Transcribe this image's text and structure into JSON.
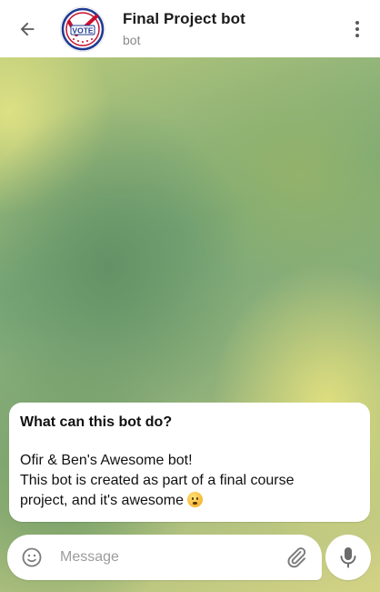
{
  "header": {
    "title": "Final Project bot",
    "subtitle": "bot",
    "avatar_text": "VOTE",
    "back_icon": "arrow-left-icon",
    "menu_icon": "more-vertical-icon"
  },
  "bot_info": {
    "heading": "What can this bot do?",
    "lines": [
      "Ofir & Ben's Awesome bot!",
      "This bot is created as part of a final course",
      "project, and it's awesome"
    ],
    "emoji": "kissing-face-emoji"
  },
  "composer": {
    "placeholder": "Message",
    "emoji_icon": "smiley-icon",
    "attach_icon": "paperclip-icon",
    "mic_icon": "microphone-icon"
  },
  "colors": {
    "header_bg": "#ffffff",
    "title": "#1b1b1b",
    "subtitle": "#8a8a8a",
    "icon": "#5a5a5a",
    "avatar_red": "#c8102e",
    "avatar_blue": "#1f3a93"
  }
}
